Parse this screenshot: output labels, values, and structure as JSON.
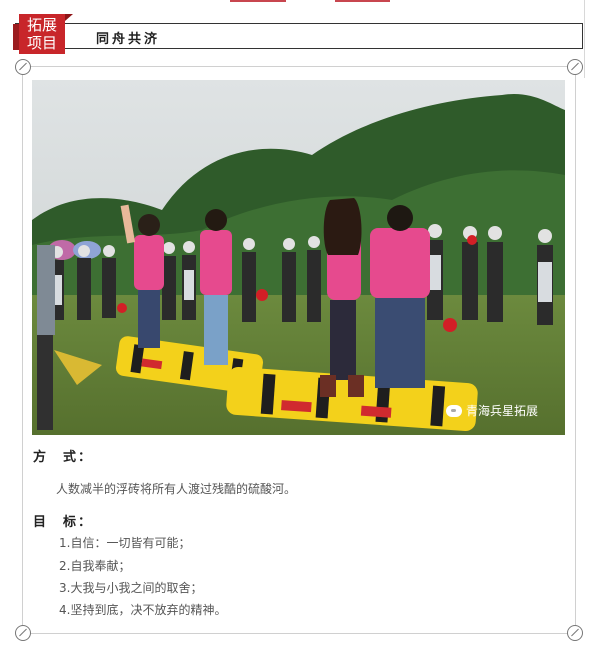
{
  "header": {
    "tag_line1": "拓展",
    "tag_line2": "项目",
    "title": "同舟共济"
  },
  "photo": {
    "watermark": "青海兵星拓展"
  },
  "method": {
    "label": "方　式：",
    "text": "人数减半的浮砖将所有人渡过残酷的硫酸河。"
  },
  "goals": {
    "label": "目　标：",
    "items": [
      "1.自信：一切皆有可能；",
      "2.自我奉献；",
      "3.大我与小我之间的取舍；",
      "4.坚持到底，决不放弃的精神。"
    ]
  },
  "colors": {
    "accent": "#c8262a",
    "shirt": "#e64a8e",
    "float": "#f3d11b"
  }
}
